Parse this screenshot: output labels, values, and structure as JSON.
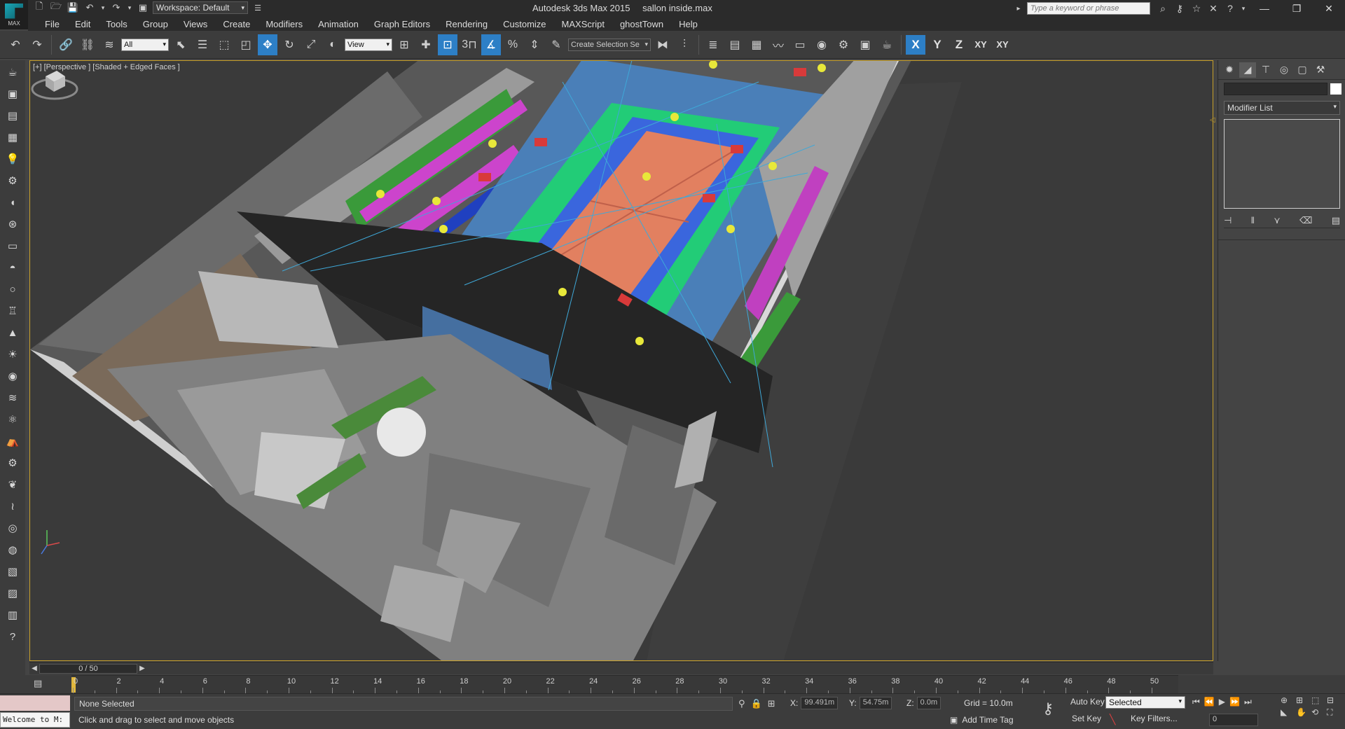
{
  "app": {
    "logo_text": "MAX",
    "title": "Autodesk 3ds Max  2015",
    "filename": "sallon inside.max",
    "workspace": "Workspace: Default",
    "search_placeholder": "Type a keyword or phrase"
  },
  "menu": [
    "File",
    "Edit",
    "Tools",
    "Group",
    "Views",
    "Create",
    "Modifiers",
    "Animation",
    "Graph Editors",
    "Rendering",
    "Customize",
    "MAXScript",
    "ghostTown",
    "Help"
  ],
  "toolbar": {
    "filter": "All",
    "ref_coord": "View",
    "snap_label": "3",
    "angle_label": "%",
    "selection_set": "Create Selection Se",
    "axes": [
      "X",
      "Y",
      "Z",
      "XY",
      "XY"
    ]
  },
  "viewport": {
    "label": "[+] [Perspective ] [Shaded + Edged Faces ]"
  },
  "command_panel": {
    "modifier_list": "Modifier List"
  },
  "time_slider": {
    "frame_display": "0 / 50"
  },
  "track": {
    "labels": [
      "0",
      "2",
      "4",
      "6",
      "8",
      "10",
      "12",
      "14",
      "16",
      "18",
      "20",
      "22",
      "24",
      "26",
      "28",
      "30",
      "32",
      "34",
      "36",
      "38",
      "40",
      "42",
      "44",
      "46",
      "48",
      "50"
    ]
  },
  "status": {
    "maxscript_text": "Welcome to M:",
    "selection": "None Selected",
    "prompt": "Click and drag to select and move objects",
    "x_label": "X:",
    "x_value": "99.491m",
    "y_label": "Y:",
    "y_value": "54.75m",
    "z_label": "Z:",
    "z_value": "0.0m",
    "grid": "Grid = 10.0m",
    "add_time_tag": "Add Time Tag",
    "auto_key": "Auto Key",
    "set_key": "Set Key",
    "selected_option": "Selected",
    "key_filters": "Key Filters...",
    "current_frame": "0"
  }
}
